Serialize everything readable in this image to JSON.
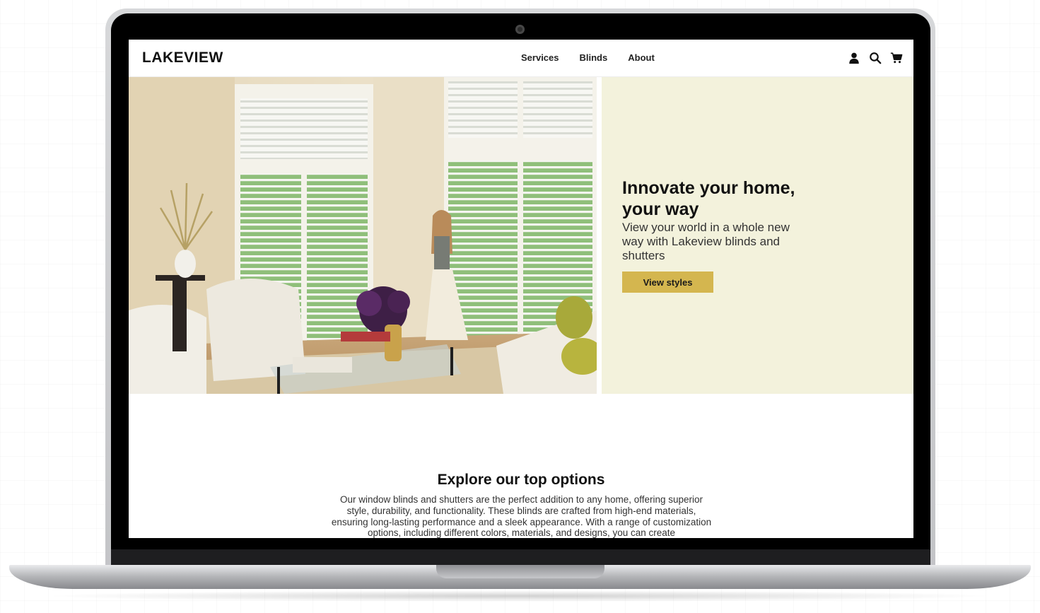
{
  "site": {
    "logo": "LAKEVIEW",
    "nav": [
      {
        "label": "Services"
      },
      {
        "label": "Blinds"
      },
      {
        "label": "About"
      }
    ],
    "icons": [
      "user-icon",
      "search-icon",
      "cart-icon"
    ]
  },
  "hero": {
    "title": "Innovate your home, your way",
    "subtitle": "View your world in a whole new way with Lakeview blinds and shutters",
    "button": "View styles",
    "panel_color": "#f3f2dc",
    "button_color": "#d4b64f"
  },
  "explore": {
    "title": "Explore our top options",
    "body": "Our window blinds and shutters are the perfect addition to any home, offering superior style, durability, and functionality. These blinds are crafted from high-end materials, ensuring long-lasting performance and a sleek appearance. With a range of customization options, including different colors, materials, and designs, you can create"
  }
}
